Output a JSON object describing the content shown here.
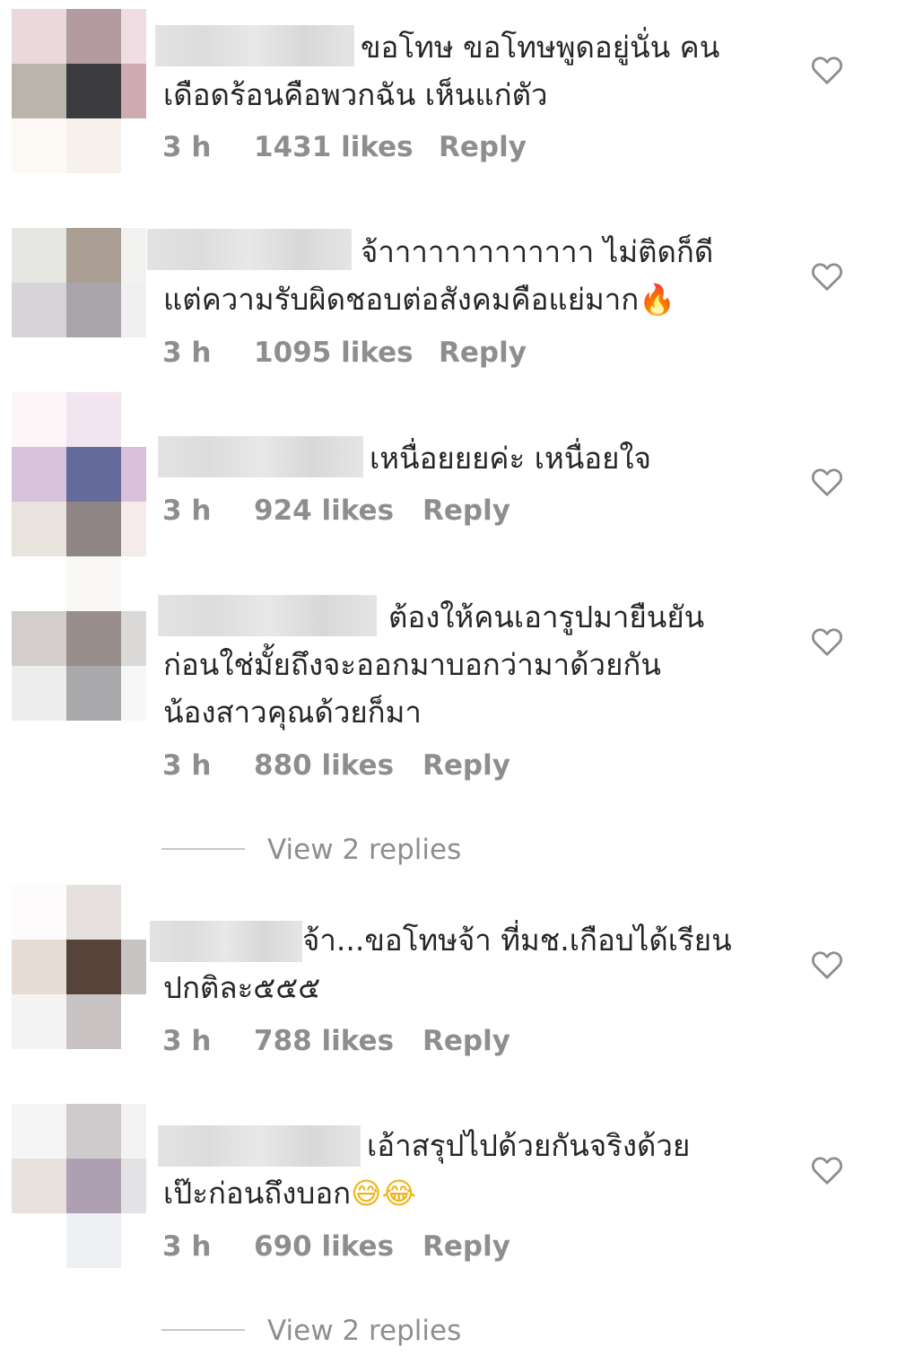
{
  "comments": [
    {
      "line1": "ขอโทษ ขอโทษพูดอยู่นั่น คน",
      "line2": "เดือดร้อนคือพวกฉัน เห็นแก่ตัว",
      "time": "3 h",
      "likes": "1431 likes",
      "reply": "Reply"
    },
    {
      "line1": "จ้าาาาาาาาาาาาา ไม่ติดก็ดี",
      "line2": "แต่ความรับผิดชอบต่อสังคมคือแย่มาก",
      "emoji": "🔥",
      "time": "3 h",
      "likes": "1095 likes",
      "reply": "Reply"
    },
    {
      "line1": "เหนื่อยยยค่ะ เหนื่อยใจ",
      "time": "3 h",
      "likes": "924 likes",
      "reply": "Reply"
    },
    {
      "line1": "ต้องให้คนเอารูปมายืนยัน",
      "line2": "ก่อนใช่มั้ยถึงจะออกมาบอกว่ามาด้วยกัน",
      "line3": "น้องสาวคุณด้วยก็มา",
      "time": "3 h",
      "likes": "880 likes",
      "reply": "Reply",
      "view_replies": "View 2 replies"
    },
    {
      "line1": "จ้า...ขอโทษจ้า ที่มช.เกือบได้เรียน",
      "line2": "ปกติละ๕๕๕",
      "time": "3 h",
      "likes": "788 likes",
      "reply": "Reply"
    },
    {
      "line1": "เอ้าสรุปไปด้วยกันจริงด้วย",
      "line2": "เป๊ะก่อนถึงบอก",
      "emoji": "😅😂",
      "time": "3 h",
      "likes": "690 likes",
      "reply": "Reply",
      "view_replies": "View 2 replies"
    }
  ],
  "icons": {
    "like": "heart-outline-icon"
  },
  "colors": {
    "text": "#262626",
    "meta": "#8e8e8e",
    "divider": "#c7c7c7",
    "heart_stroke": "#8e8e8e"
  }
}
